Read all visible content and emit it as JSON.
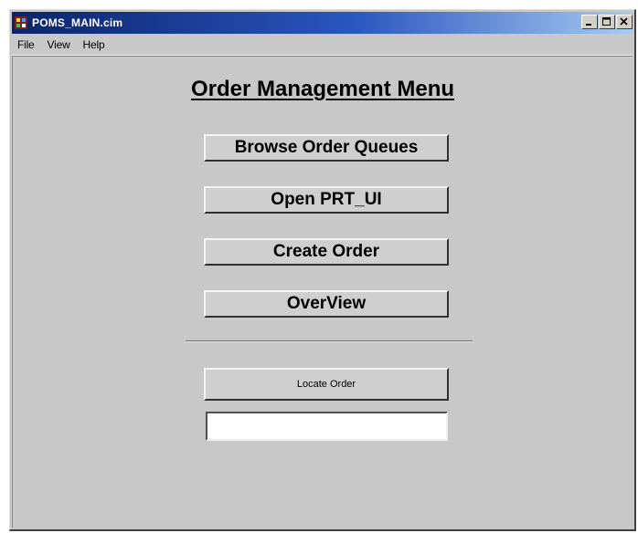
{
  "window": {
    "title": "POMS_MAIN.cim"
  },
  "menubar": {
    "items": [
      {
        "label": "File"
      },
      {
        "label": "View"
      },
      {
        "label": "Help"
      }
    ]
  },
  "main": {
    "title": "Order Management Menu",
    "buttons": {
      "browse_order_queues": "Browse Order Queues",
      "open_prt_ui": "Open PRT_UI",
      "create_order": "Create Order",
      "overview": "OverView",
      "locate_order": "Locate Order"
    },
    "locate_order_input": {
      "value": "",
      "placeholder": ""
    }
  },
  "colors": {
    "window_background": "#c8c8c8",
    "titlebar_start": "#0a246a",
    "titlebar_end": "#a6caf0",
    "button_face": "#cfcfcf"
  },
  "icons": {
    "app": "poms-app-icon",
    "minimize": "minimize-icon",
    "maximize": "maximize-icon",
    "close": "close-icon"
  }
}
